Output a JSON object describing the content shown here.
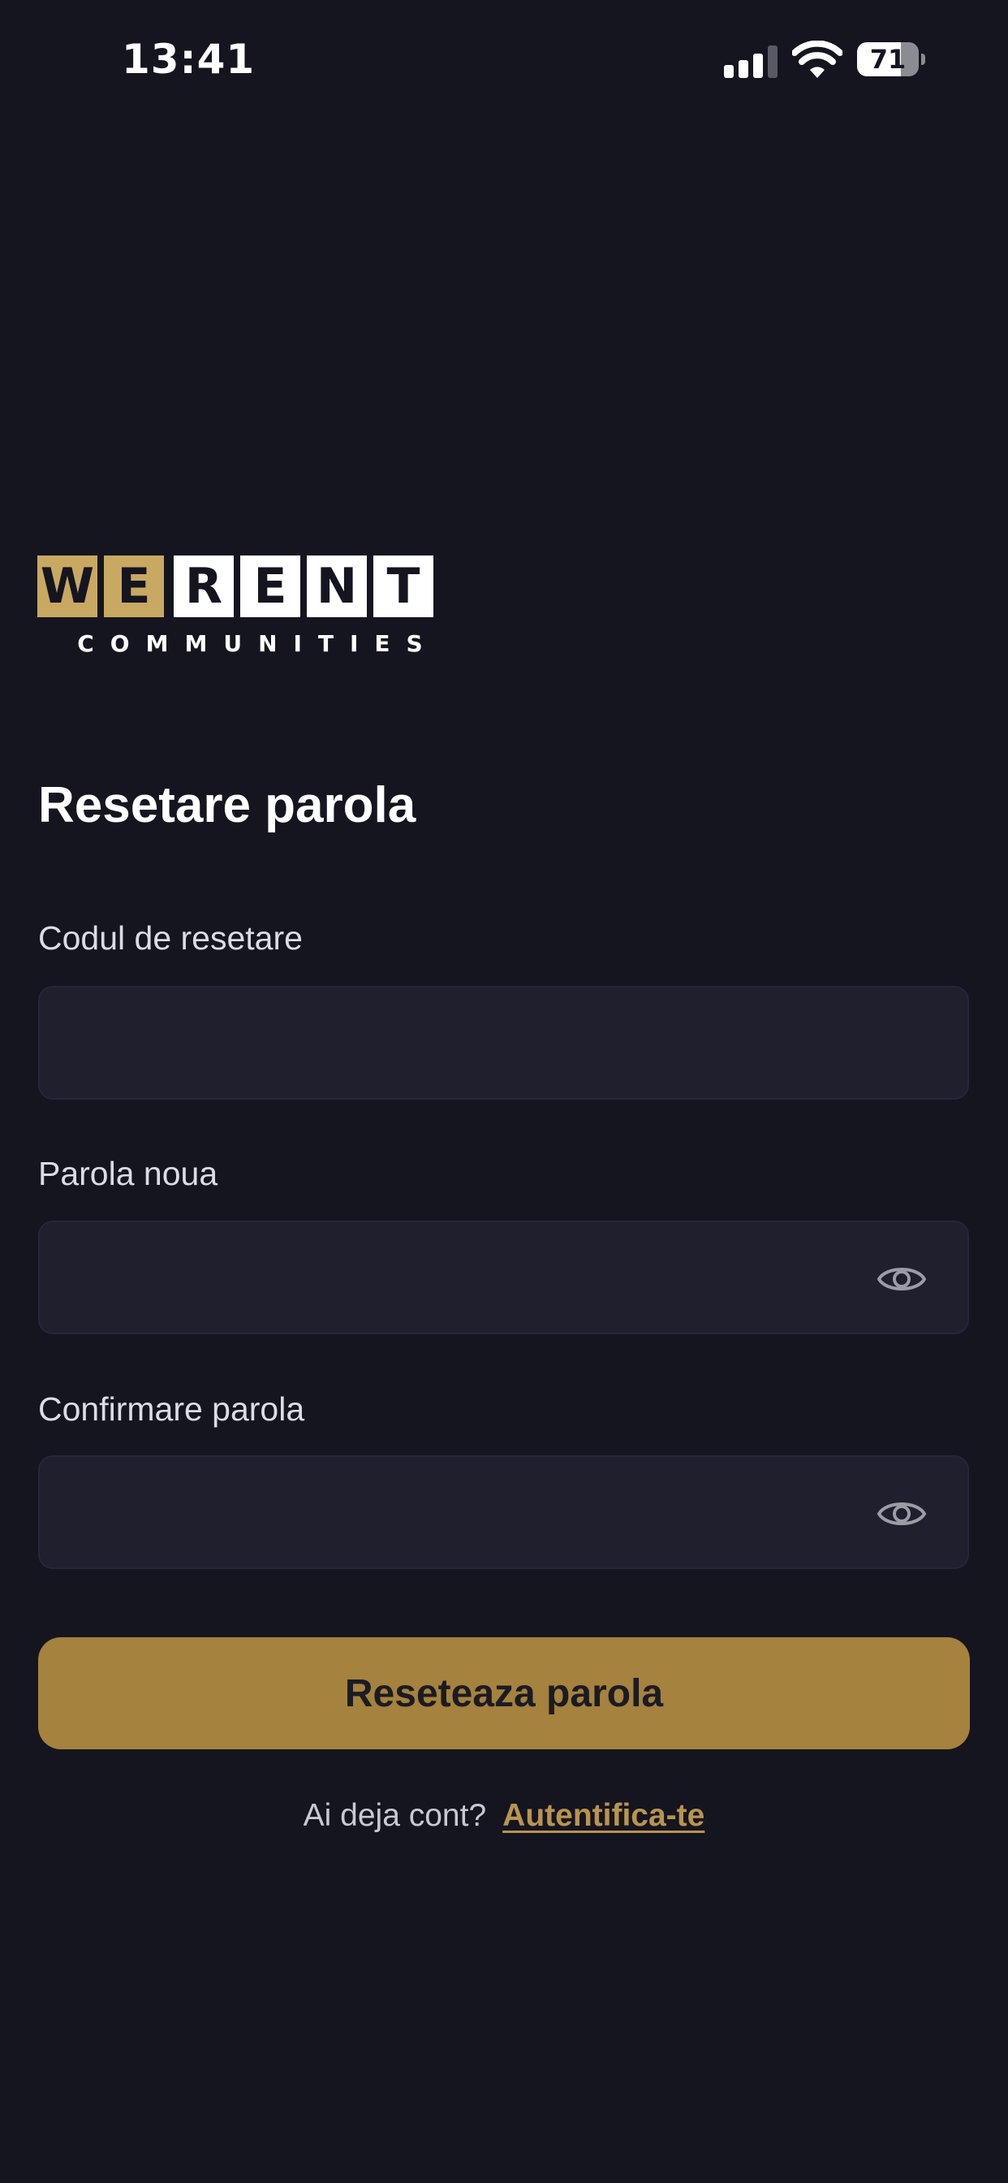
{
  "status_bar": {
    "time": "13:41",
    "battery_level": 71,
    "battery_label": "71",
    "signal_bars_active": 3,
    "signal_bars_total": 4
  },
  "logo": {
    "tiles": [
      "W",
      "E",
      "R",
      "E",
      "N",
      "T"
    ],
    "subtitle": "COMMUNITIES",
    "colors": {
      "gold": "#c9a862",
      "white": "#ffffff"
    }
  },
  "form": {
    "title": "Resetare parola",
    "fields": [
      {
        "label": "Codul de resetare",
        "value": "",
        "placeholder": ""
      },
      {
        "label": "Parola noua",
        "value": "",
        "placeholder": "",
        "icon": "eye-icon"
      },
      {
        "label": "Confirmare parola",
        "value": "",
        "placeholder": "",
        "icon": "eye-icon"
      }
    ],
    "submit_label": "Reseteaza parola"
  },
  "footer": {
    "prompt": "Ai deja cont?",
    "link_label": "Autentifica-te"
  },
  "colors": {
    "background": "#151520",
    "input_background": "#1f1f2d",
    "accent": "#a5823d",
    "link": "#b8944f"
  }
}
